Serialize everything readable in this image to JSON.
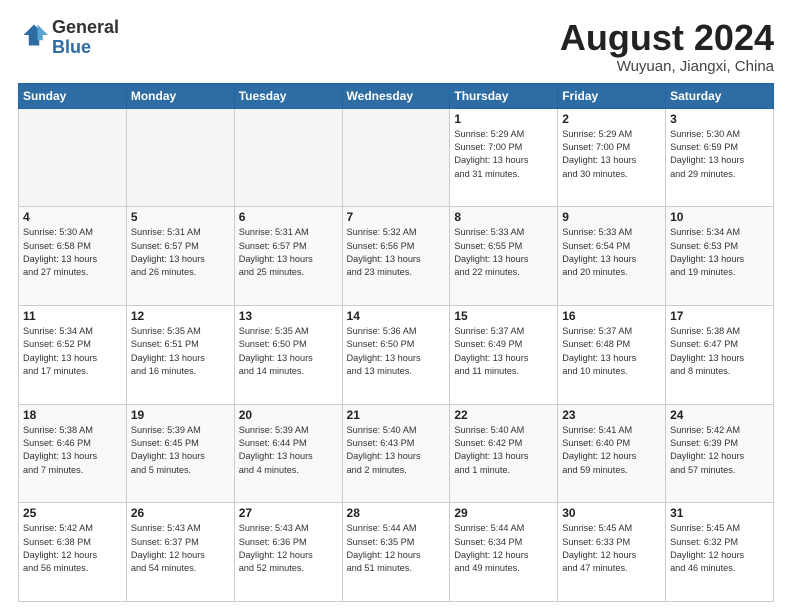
{
  "logo": {
    "general": "General",
    "blue": "Blue"
  },
  "title": {
    "month": "August 2024",
    "location": "Wuyuan, Jiangxi, China"
  },
  "weekdays": [
    "Sunday",
    "Monday",
    "Tuesday",
    "Wednesday",
    "Thursday",
    "Friday",
    "Saturday"
  ],
  "weeks": [
    [
      {
        "day": "",
        "info": ""
      },
      {
        "day": "",
        "info": ""
      },
      {
        "day": "",
        "info": ""
      },
      {
        "day": "",
        "info": ""
      },
      {
        "day": "1",
        "info": "Sunrise: 5:29 AM\nSunset: 7:00 PM\nDaylight: 13 hours\nand 31 minutes."
      },
      {
        "day": "2",
        "info": "Sunrise: 5:29 AM\nSunset: 7:00 PM\nDaylight: 13 hours\nand 30 minutes."
      },
      {
        "day": "3",
        "info": "Sunrise: 5:30 AM\nSunset: 6:59 PM\nDaylight: 13 hours\nand 29 minutes."
      }
    ],
    [
      {
        "day": "4",
        "info": "Sunrise: 5:30 AM\nSunset: 6:58 PM\nDaylight: 13 hours\nand 27 minutes."
      },
      {
        "day": "5",
        "info": "Sunrise: 5:31 AM\nSunset: 6:57 PM\nDaylight: 13 hours\nand 26 minutes."
      },
      {
        "day": "6",
        "info": "Sunrise: 5:31 AM\nSunset: 6:57 PM\nDaylight: 13 hours\nand 25 minutes."
      },
      {
        "day": "7",
        "info": "Sunrise: 5:32 AM\nSunset: 6:56 PM\nDaylight: 13 hours\nand 23 minutes."
      },
      {
        "day": "8",
        "info": "Sunrise: 5:33 AM\nSunset: 6:55 PM\nDaylight: 13 hours\nand 22 minutes."
      },
      {
        "day": "9",
        "info": "Sunrise: 5:33 AM\nSunset: 6:54 PM\nDaylight: 13 hours\nand 20 minutes."
      },
      {
        "day": "10",
        "info": "Sunrise: 5:34 AM\nSunset: 6:53 PM\nDaylight: 13 hours\nand 19 minutes."
      }
    ],
    [
      {
        "day": "11",
        "info": "Sunrise: 5:34 AM\nSunset: 6:52 PM\nDaylight: 13 hours\nand 17 minutes."
      },
      {
        "day": "12",
        "info": "Sunrise: 5:35 AM\nSunset: 6:51 PM\nDaylight: 13 hours\nand 16 minutes."
      },
      {
        "day": "13",
        "info": "Sunrise: 5:35 AM\nSunset: 6:50 PM\nDaylight: 13 hours\nand 14 minutes."
      },
      {
        "day": "14",
        "info": "Sunrise: 5:36 AM\nSunset: 6:50 PM\nDaylight: 13 hours\nand 13 minutes."
      },
      {
        "day": "15",
        "info": "Sunrise: 5:37 AM\nSunset: 6:49 PM\nDaylight: 13 hours\nand 11 minutes."
      },
      {
        "day": "16",
        "info": "Sunrise: 5:37 AM\nSunset: 6:48 PM\nDaylight: 13 hours\nand 10 minutes."
      },
      {
        "day": "17",
        "info": "Sunrise: 5:38 AM\nSunset: 6:47 PM\nDaylight: 13 hours\nand 8 minutes."
      }
    ],
    [
      {
        "day": "18",
        "info": "Sunrise: 5:38 AM\nSunset: 6:46 PM\nDaylight: 13 hours\nand 7 minutes."
      },
      {
        "day": "19",
        "info": "Sunrise: 5:39 AM\nSunset: 6:45 PM\nDaylight: 13 hours\nand 5 minutes."
      },
      {
        "day": "20",
        "info": "Sunrise: 5:39 AM\nSunset: 6:44 PM\nDaylight: 13 hours\nand 4 minutes."
      },
      {
        "day": "21",
        "info": "Sunrise: 5:40 AM\nSunset: 6:43 PM\nDaylight: 13 hours\nand 2 minutes."
      },
      {
        "day": "22",
        "info": "Sunrise: 5:40 AM\nSunset: 6:42 PM\nDaylight: 13 hours\nand 1 minute."
      },
      {
        "day": "23",
        "info": "Sunrise: 5:41 AM\nSunset: 6:40 PM\nDaylight: 12 hours\nand 59 minutes."
      },
      {
        "day": "24",
        "info": "Sunrise: 5:42 AM\nSunset: 6:39 PM\nDaylight: 12 hours\nand 57 minutes."
      }
    ],
    [
      {
        "day": "25",
        "info": "Sunrise: 5:42 AM\nSunset: 6:38 PM\nDaylight: 12 hours\nand 56 minutes."
      },
      {
        "day": "26",
        "info": "Sunrise: 5:43 AM\nSunset: 6:37 PM\nDaylight: 12 hours\nand 54 minutes."
      },
      {
        "day": "27",
        "info": "Sunrise: 5:43 AM\nSunset: 6:36 PM\nDaylight: 12 hours\nand 52 minutes."
      },
      {
        "day": "28",
        "info": "Sunrise: 5:44 AM\nSunset: 6:35 PM\nDaylight: 12 hours\nand 51 minutes."
      },
      {
        "day": "29",
        "info": "Sunrise: 5:44 AM\nSunset: 6:34 PM\nDaylight: 12 hours\nand 49 minutes."
      },
      {
        "day": "30",
        "info": "Sunrise: 5:45 AM\nSunset: 6:33 PM\nDaylight: 12 hours\nand 47 minutes."
      },
      {
        "day": "31",
        "info": "Sunrise: 5:45 AM\nSunset: 6:32 PM\nDaylight: 12 hours\nand 46 minutes."
      }
    ]
  ]
}
